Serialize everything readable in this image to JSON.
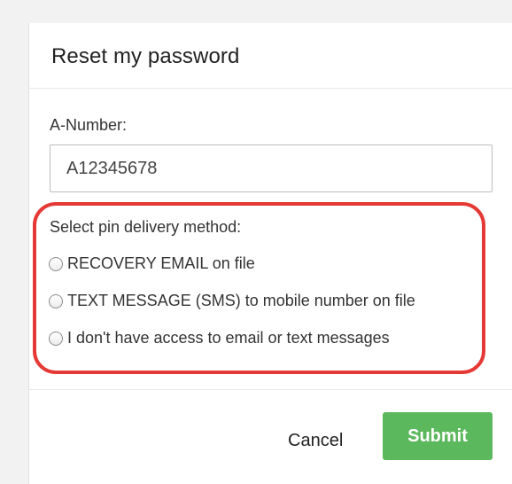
{
  "modal": {
    "title": "Reset my password"
  },
  "a_number": {
    "label": "A-Number:",
    "value": "A12345678"
  },
  "delivery": {
    "label": "Select pin delivery method:",
    "options": [
      "RECOVERY EMAIL on file",
      "TEXT MESSAGE (SMS) to mobile number on file",
      "I don't have access to email or text messages"
    ],
    "selected": null,
    "highlight_color": "#e53935"
  },
  "footer": {
    "cancel_label": "Cancel",
    "submit_label": "Submit",
    "submit_color": "#5cb85c"
  }
}
